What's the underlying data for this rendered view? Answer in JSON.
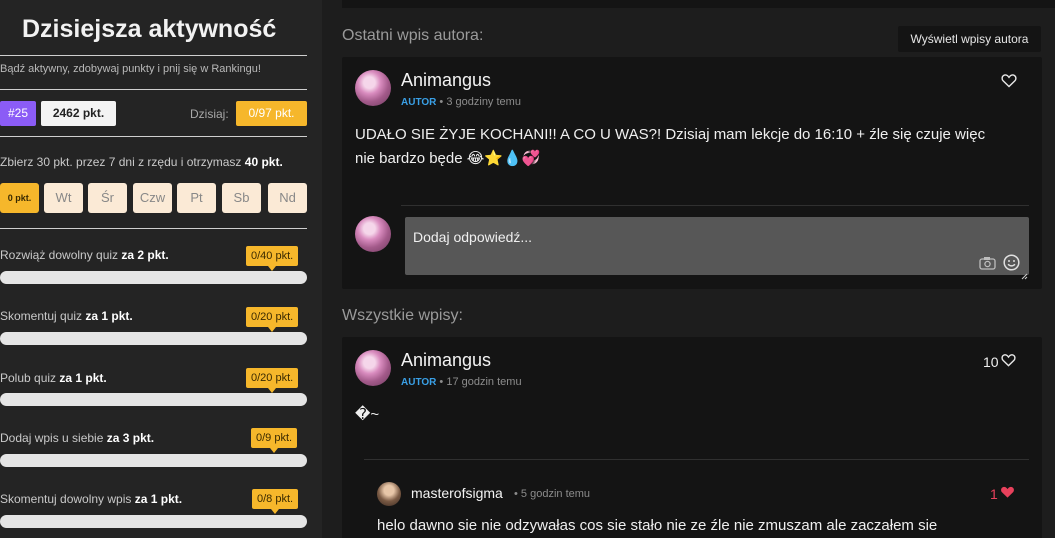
{
  "sidebar": {
    "title": "Dzisiejsza aktywność",
    "subtitle": "Bądź aktywny, zdobywaj punkty i pnij się w Rankingu!",
    "rank": "#25",
    "points": "2462 pkt.",
    "today_label": "Dzisiaj:",
    "today_value": "0/97 pkt.",
    "streak_prefix": "Zbierz 30 pkt. przez 7 dni z rzędu i otrzymasz ",
    "streak_bonus": "40 pkt.",
    "days": [
      "0 pkt.",
      "Wt",
      "Śr",
      "Czw",
      "Pt",
      "Sb",
      "Nd"
    ],
    "tasks": [
      {
        "text": "Rozwiąż dowolny quiz ",
        "bold": "za 2 pkt.",
        "progress": "0/40 pkt."
      },
      {
        "text": "Skomentuj quiz ",
        "bold": "za 1 pkt.",
        "progress": "0/20 pkt."
      },
      {
        "text": "Polub quiz ",
        "bold": "za 1 pkt.",
        "progress": "0/20 pkt."
      },
      {
        "text": "Dodaj wpis u siebie ",
        "bold": "za 3 pkt.",
        "progress": "0/9 pkt."
      },
      {
        "text": "Skomentuj dowolny wpis ",
        "bold": "za 1 pkt.",
        "progress": "0/8 pkt."
      }
    ]
  },
  "main": {
    "last_post_label": "Ostatni wpis autora:",
    "view_author_button": "Wyświetl wpisy autora",
    "all_posts_label": "Wszystkie wpisy:",
    "last_post": {
      "author": "Animangus",
      "role": "AUTOR",
      "time": "3 godziny temu",
      "text": "UDAŁO SIE ŻYJE KOCHANI!! A CO U WAS?! Dzisiaj mam lekcje do 16:10 + źle się czuje więc nie bardzo będe 😂⭐💧💞",
      "reply_placeholder": "Dodaj odpowiedź..."
    },
    "post2": {
      "author": "Animangus",
      "role": "AUTOR",
      "time": "17 godzin temu",
      "likes": "10",
      "text": "�~"
    },
    "comment": {
      "author": "masterofsigma",
      "time": "5 godzin temu",
      "likes": "1",
      "text": "helo dawno sie nie odzywałas cos sie stało nie ze źle nie zmuszam ale zaczałem sie"
    }
  },
  "colors": {
    "accent_yellow": "#f6b72b",
    "rank_purple": "#8b5cf6",
    "author_blue": "#3aa0e6",
    "like_red": "#e8415c"
  },
  "icons": [
    "heart-icon",
    "camera-icon",
    "smiley-icon",
    "resize-icon"
  ]
}
